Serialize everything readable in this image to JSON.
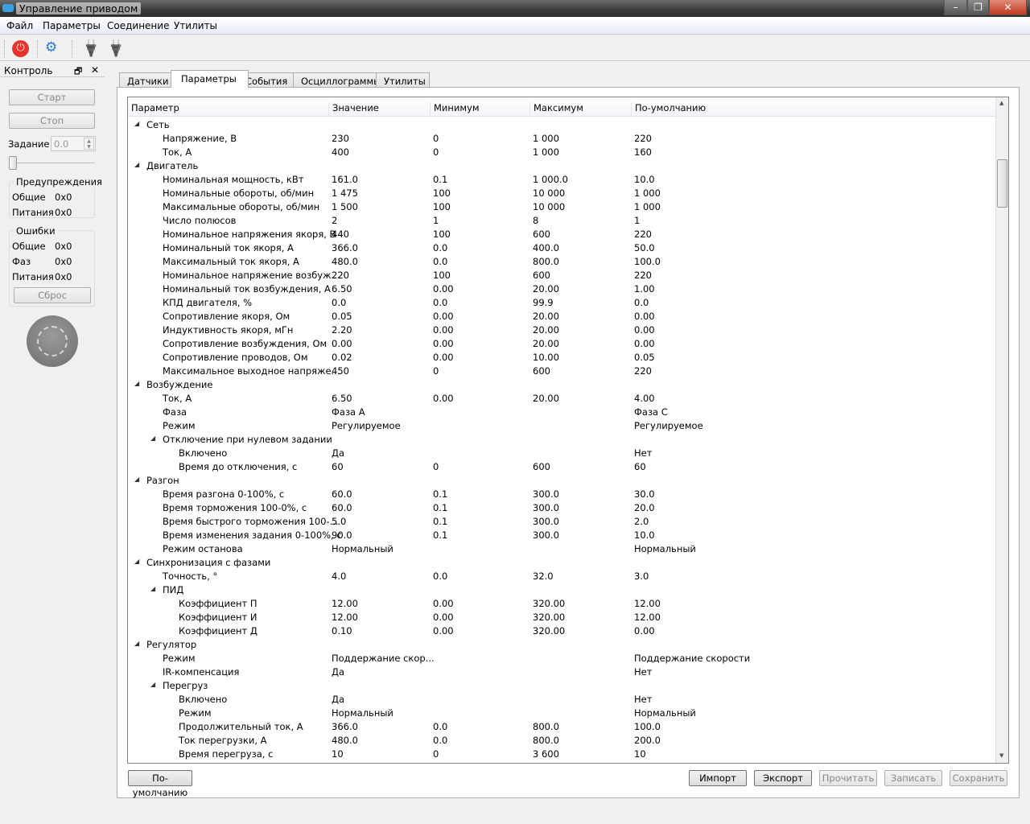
{
  "window": {
    "title": "Управление приводом",
    "minimize": "–",
    "restore": "❐",
    "close": "✕"
  },
  "menu": [
    "Файл",
    "Параметры",
    "Соединение",
    "Утилиты"
  ],
  "toolbar": {
    "power_color": "#e8322c",
    "icons": [
      "power-icon",
      "settings-gears-icon",
      "connect-plug-icon",
      "disconnect-plug-icon"
    ]
  },
  "control": {
    "title": "Контроль",
    "float": "🗗",
    "close": "✕",
    "start": "Старт",
    "stop": "Стоп",
    "setpoint_label": "Задание",
    "setpoint_value": "0.0",
    "slider_level": 0,
    "warnings": {
      "title": "Предупреждения",
      "rows": [
        [
          "Общие",
          "0x0"
        ],
        [
          "Питания",
          "0x0"
        ]
      ]
    },
    "errors": {
      "title": "Ошибки",
      "rows": [
        [
          "Общие",
          "0x0"
        ],
        [
          "Фаз",
          "0x0"
        ],
        [
          "Питания",
          "0x0"
        ]
      ]
    },
    "reset": "Сброс"
  },
  "tabs": [
    "Датчики",
    "Параметры",
    "События",
    "Осциллограммы",
    "Утилиты"
  ],
  "active_tab": 1,
  "table": {
    "columns": [
      "Параметр",
      "Значение",
      "Минимум",
      "Максимум",
      "По-умолчанию"
    ],
    "rows": [
      [
        0,
        "Сеть"
      ],
      [
        1,
        "Напряжение, В",
        "230",
        "0",
        "1 000",
        "220"
      ],
      [
        1,
        "Ток, А",
        "400",
        "0",
        "1 000",
        "160"
      ],
      [
        0,
        "Двигатель"
      ],
      [
        1,
        "Номинальная мощность, кВт",
        "161.0",
        "0.1",
        "1 000.0",
        "10.0"
      ],
      [
        1,
        "Номинальные обороты, об/мин",
        "1 475",
        "100",
        "10 000",
        "1 000"
      ],
      [
        1,
        "Максимальные обороты, об/мин",
        "1 500",
        "100",
        "10 000",
        "1 000"
      ],
      [
        1,
        "Число полюсов",
        "2",
        "1",
        "8",
        "1"
      ],
      [
        1,
        "Номинальное напряжения якоря, В",
        "440",
        "100",
        "600",
        "220"
      ],
      [
        1,
        "Номинальный ток якоря, А",
        "366.0",
        "0.0",
        "400.0",
        "50.0"
      ],
      [
        1,
        "Максимальный ток якоря, А",
        "480.0",
        "0.0",
        "800.0",
        "100.0"
      ],
      [
        1,
        "Номинальное напряжение возбуж...",
        "220",
        "100",
        "600",
        "220"
      ],
      [
        1,
        "Номинальный ток возбуждения, А",
        "6.50",
        "0.00",
        "20.00",
        "1.00"
      ],
      [
        1,
        "КПД двигателя, %",
        "0.0",
        "0.0",
        "99.9",
        "0.0"
      ],
      [
        1,
        "Сопротивление якоря, Ом",
        "0.05",
        "0.00",
        "20.00",
        "0.00"
      ],
      [
        1,
        "Индуктивность якоря, мГн",
        "2.20",
        "0.00",
        "20.00",
        "0.00"
      ],
      [
        1,
        "Сопротивление возбуждения, Ом",
        "0.00",
        "0.00",
        "20.00",
        "0.00"
      ],
      [
        1,
        "Сопротивление проводов, Ом",
        "0.02",
        "0.00",
        "10.00",
        "0.05"
      ],
      [
        1,
        "Максимальное выходное напряже...",
        "450",
        "0",
        "600",
        "220"
      ],
      [
        0,
        "Возбуждение"
      ],
      [
        1,
        "Ток, А",
        "6.50",
        "0.00",
        "20.00",
        "4.00"
      ],
      [
        1,
        "Фаза",
        "Фаза A",
        "",
        "",
        "Фаза C"
      ],
      [
        1,
        "Режим",
        "Регулируемое",
        "",
        "",
        "Регулируемое"
      ],
      [
        1,
        "Отключение при нулевом задании",
        null
      ],
      [
        2,
        "Включено",
        "Да",
        "",
        "",
        "Нет"
      ],
      [
        2,
        "Время до отключения, с",
        "60",
        "0",
        "600",
        "60"
      ],
      [
        0,
        "Разгон"
      ],
      [
        1,
        "Время разгона 0-100%, с",
        "60.0",
        "0.1",
        "300.0",
        "30.0"
      ],
      [
        1,
        "Время торможения 100-0%, с",
        "60.0",
        "0.1",
        "300.0",
        "20.0"
      ],
      [
        1,
        "Время быстрого торможения 100-...",
        "5.0",
        "0.1",
        "300.0",
        "2.0"
      ],
      [
        1,
        "Время изменения задания 0-100%, с",
        "90.0",
        "0.1",
        "300.0",
        "10.0"
      ],
      [
        1,
        "Режим останова",
        "Нормальный",
        "",
        "",
        "Нормальный"
      ],
      [
        0,
        "Синхронизация с фазами"
      ],
      [
        1,
        "Точность, °",
        "4.0",
        "0.0",
        "32.0",
        "3.0"
      ],
      [
        1,
        "ПИД",
        null
      ],
      [
        2,
        "Коэффициент П",
        "12.00",
        "0.00",
        "320.00",
        "12.00"
      ],
      [
        2,
        "Коэффициент И",
        "12.00",
        "0.00",
        "320.00",
        "12.00"
      ],
      [
        2,
        "Коэффициент Д",
        "0.10",
        "0.00",
        "320.00",
        "0.00"
      ],
      [
        0,
        "Регулятор"
      ],
      [
        1,
        "Режим",
        "Поддержание скор...",
        "",
        "",
        "Поддержание скорости"
      ],
      [
        1,
        "IR-компенсация",
        "Да",
        "",
        "",
        "Нет"
      ],
      [
        1,
        "Перегруз",
        null
      ],
      [
        2,
        "Включено",
        "Да",
        "",
        "",
        "Нет"
      ],
      [
        2,
        "Режим",
        "Нормальный",
        "",
        "",
        "Нормальный"
      ],
      [
        2,
        "Продолжительный ток, А",
        "366.0",
        "0.0",
        "800.0",
        "100.0"
      ],
      [
        2,
        "Ток перегрузки, А",
        "480.0",
        "0.0",
        "800.0",
        "200.0"
      ],
      [
        2,
        "Время перегруза, с",
        "10",
        "0",
        "3 600",
        "10"
      ]
    ]
  },
  "buttons": {
    "defaults": "По-умолчанию",
    "import": "Импорт",
    "export": "Экспорт",
    "read": "Прочитать",
    "write": "Записать",
    "save": "Сохранить"
  }
}
